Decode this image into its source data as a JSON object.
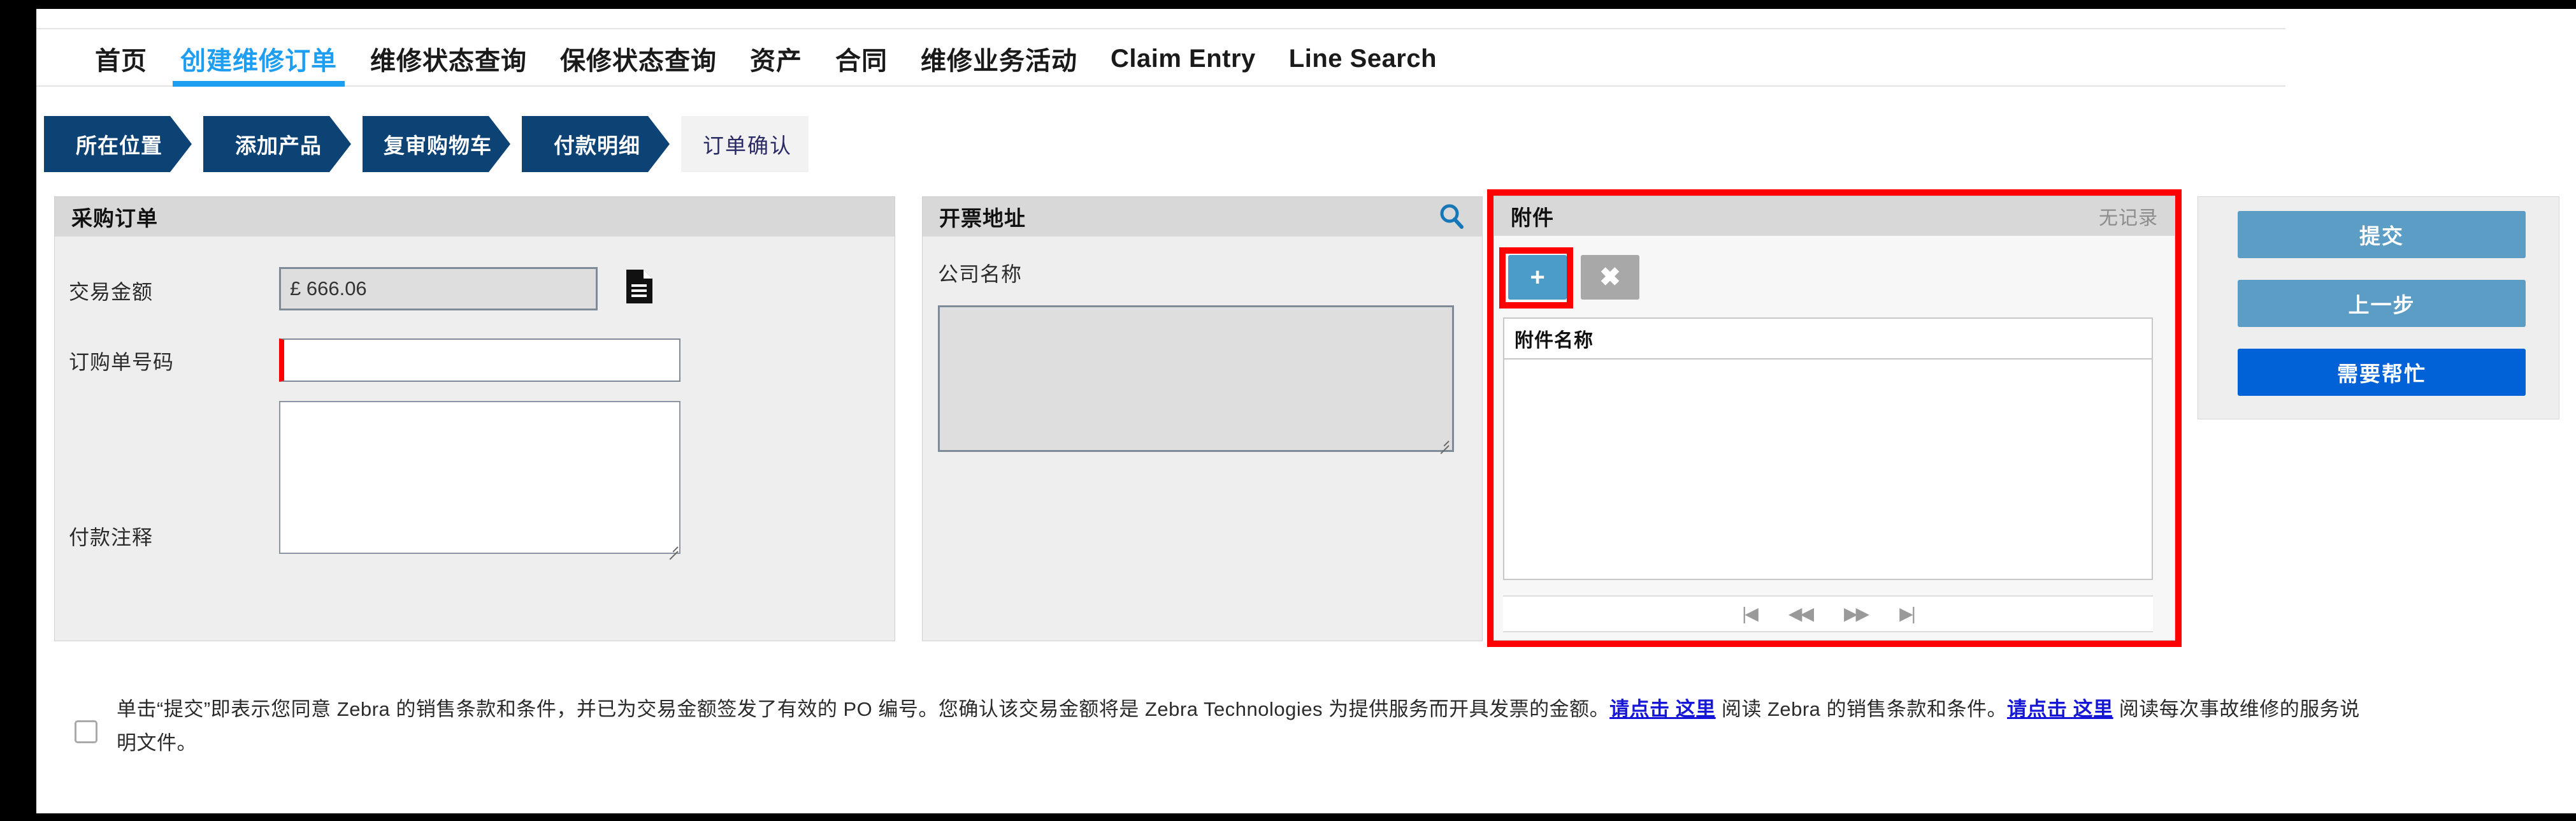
{
  "nav": {
    "tabs": [
      {
        "label": "首页",
        "active": false,
        "cjk": true
      },
      {
        "label": "创建维修订单",
        "active": true,
        "cjk": true
      },
      {
        "label": "维修状态查询",
        "active": false,
        "cjk": true
      },
      {
        "label": "保修状态查询",
        "active": false,
        "cjk": true
      },
      {
        "label": "资产",
        "active": false,
        "cjk": true
      },
      {
        "label": "合同",
        "active": false,
        "cjk": true
      },
      {
        "label": "维修业务活动",
        "active": false,
        "cjk": true
      },
      {
        "label": "Claim Entry",
        "active": false,
        "cjk": false
      },
      {
        "label": "Line Search",
        "active": false,
        "cjk": false
      }
    ]
  },
  "steps": [
    {
      "label": "所在位置",
      "state": "done"
    },
    {
      "label": "添加产品",
      "state": "done"
    },
    {
      "label": "复审购物车",
      "state": "done"
    },
    {
      "label": "付款明细",
      "state": "current"
    },
    {
      "label": "订单确认",
      "state": "inactive"
    }
  ],
  "purchase_order": {
    "title": "采购订单",
    "amount_label": "交易金额",
    "amount_value": "£ 666.06",
    "doc_icon": "document-icon",
    "po_label": "订购单号码",
    "po_value": "",
    "po_placeholder": "",
    "notes_label": "付款注释",
    "notes_value": "",
    "notes_placeholder": ""
  },
  "billing_address": {
    "title": "开票地址",
    "search_icon": "search-icon",
    "company_label": "公司名称",
    "company_value": "",
    "company_placeholder": ""
  },
  "attachments": {
    "title": "附件",
    "record_status": "无记录",
    "add_label": "+",
    "delete_label": "✖",
    "column_header": "附件名称",
    "rows": [],
    "pager": {
      "first": "first-page-icon",
      "prev": "previous-page-icon",
      "next": "next-page-icon",
      "last": "last-page-icon"
    }
  },
  "actions": {
    "submit": "提交",
    "previous": "上一步",
    "help": "需要帮忙"
  },
  "terms": {
    "checked": false,
    "part1": "单击“提交”即表示您同意 Zebra 的销售条款和条件，并已为交易金额签发了有效的 PO 编号。您确认该交易金额将是 Zebra Technologies 为提供服务而开具发票的金额。",
    "link1": "请点击 这里",
    "part2": " 阅读 Zebra 的销售条款和条件。",
    "link2": "请点击 这里",
    "part3": " 阅读每次事故维修的服务说明文件。"
  },
  "colors": {
    "accent_blue": "#1e9ef0",
    "step_blue": "#0d4275",
    "button_blue": "#5b9dc4",
    "help_blue": "#0062d6",
    "highlight_red": "#fe0000",
    "required_red": "#ff0000"
  }
}
